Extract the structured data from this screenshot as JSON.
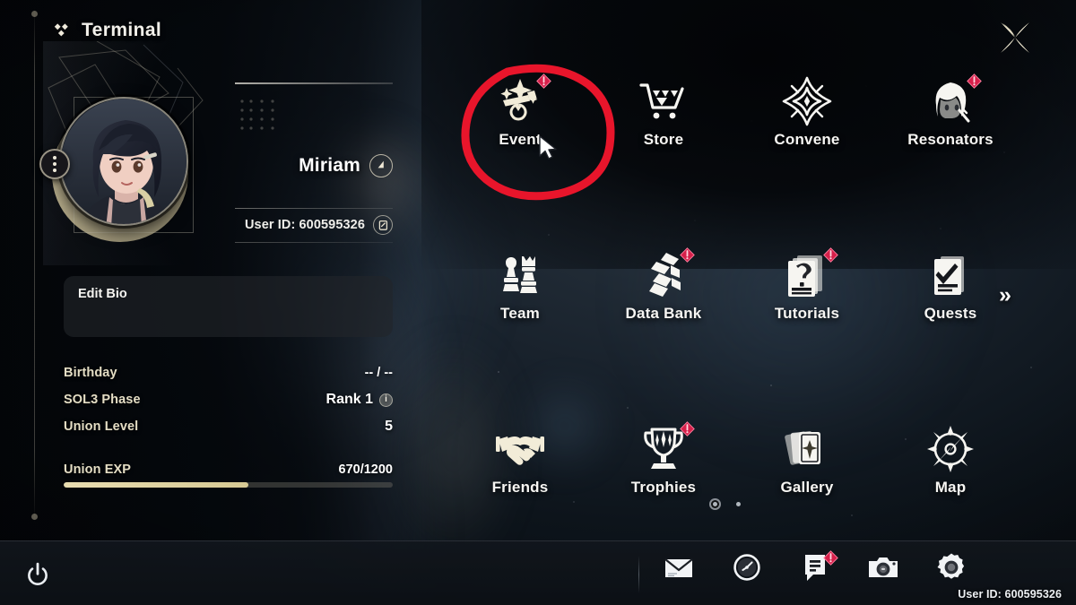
{
  "window": {
    "title": "Terminal",
    "title_icon": "terminal-diamond-icon",
    "close_icon": "close-x-icon"
  },
  "profile": {
    "avatar_icon": "player-avatar",
    "avatar_menu_icon": "more-options-icon",
    "player_name": "Miriam",
    "name_badge_icon": "level-badge-icon",
    "user_id_label": "User ID: 600595326",
    "copy_icon": "copy-icon",
    "edit_bio_label": "Edit Bio"
  },
  "stats": [
    {
      "key": "Birthday",
      "value": "-- / --",
      "info": false
    },
    {
      "key": "SOL3 Phase",
      "value": "Rank 1",
      "info": true,
      "info_icon": "info-icon"
    },
    {
      "key": "Union Level",
      "value": "5",
      "info": false
    }
  ],
  "union_exp": {
    "label": "Union EXP",
    "value": "670/1200",
    "current": 670,
    "max": 1200,
    "percent": 56,
    "bar_color": "#e8dcb0"
  },
  "menu": {
    "items": [
      {
        "label": "Event",
        "icon": "event-wand-stars-icon",
        "badge": true,
        "highlighted": true
      },
      {
        "label": "Store",
        "icon": "store-cart-icon",
        "badge": false,
        "highlighted": false
      },
      {
        "label": "Convene",
        "icon": "convene-star-icon",
        "badge": false,
        "highlighted": false
      },
      {
        "label": "Resonators",
        "icon": "resonators-character-icon",
        "badge": true,
        "highlighted": false
      },
      {
        "label": "Team",
        "icon": "team-chess-icon",
        "badge": false,
        "highlighted": false
      },
      {
        "label": "Data Bank",
        "icon": "data-bank-icon",
        "badge": true,
        "highlighted": false
      },
      {
        "label": "Tutorials",
        "icon": "tutorials-question-icon",
        "badge": true,
        "highlighted": false
      },
      {
        "label": "Quests",
        "icon": "quests-check-icon",
        "badge": false,
        "highlighted": false
      },
      {
        "label": "Friends",
        "icon": "friends-handshake-icon",
        "badge": false,
        "highlighted": false
      },
      {
        "label": "Trophies",
        "icon": "trophies-cup-icon",
        "badge": true,
        "highlighted": false
      },
      {
        "label": "Gallery",
        "icon": "gallery-cards-icon",
        "badge": false,
        "highlighted": false
      },
      {
        "label": "Map",
        "icon": "map-compass-icon",
        "badge": false,
        "highlighted": false
      }
    ],
    "next_page_label": "»",
    "next_page_icon": "chevron-double-right-icon",
    "pages": 2,
    "active_page": 1
  },
  "annotation": {
    "shape": "hand-drawn-circle",
    "color": "#e8152b",
    "target": "Event",
    "cursor_icon": "mouse-cursor"
  },
  "taskbar": {
    "power_icon": "power-icon",
    "items": [
      {
        "icon": "mail-icon",
        "badge": false
      },
      {
        "icon": "clock-icon",
        "badge": false
      },
      {
        "icon": "feedback-icon",
        "badge": true
      },
      {
        "icon": "camera-icon",
        "badge": false
      },
      {
        "icon": "settings-gear-icon",
        "badge": false
      }
    ],
    "user_id_label": "User ID: 600595326"
  },
  "theme": {
    "accent_cream": "#e4ddc4",
    "badge_red": "#d6204a",
    "text_white": "#ffffff",
    "panel_dark": "#0a0e13"
  }
}
